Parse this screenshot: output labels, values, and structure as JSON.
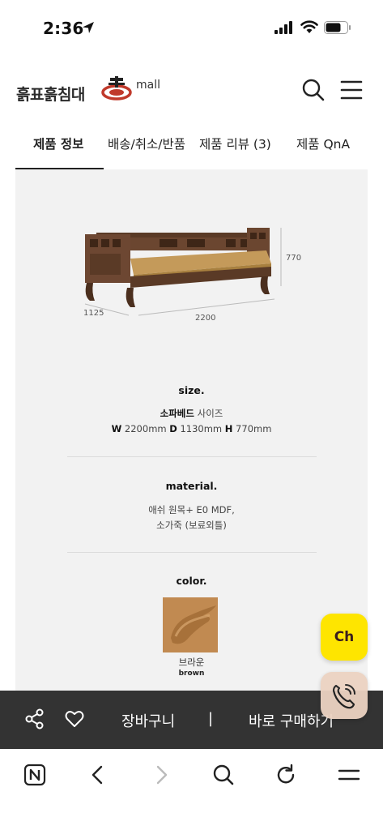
{
  "status_bar": {
    "time": "2:36",
    "icons": [
      "location-arrow-icon",
      "cellular-signal-icon",
      "wifi-icon",
      "battery-icon"
    ]
  },
  "header": {
    "logo_text": "흙표흙침대",
    "logo_suffix": "mall",
    "icons": [
      "search-icon",
      "hamburger-menu-icon"
    ]
  },
  "tabs": [
    {
      "label": "제품 정보",
      "active": true
    },
    {
      "label": "배송/취소/반품",
      "active": false
    },
    {
      "label": "제품 리뷰 (3)",
      "active": false
    },
    {
      "label": "제품 QnA",
      "active": false
    }
  ],
  "product": {
    "dimensions": {
      "height": "770",
      "depth": "1125",
      "width": "2200"
    },
    "size": {
      "title": "size.",
      "line1_bold": "소파베드",
      "line1_rest": " 사이즈",
      "w_label": "W",
      "w_value": " 2200mm ",
      "d_label": "D",
      "d_value": " 1130mm ",
      "h_label": "H",
      "h_value": " 770mm"
    },
    "material": {
      "title": "material.",
      "line1": "애쉬 원목+ E0 MDF,",
      "line2": "소가죽 (보료외틀)"
    },
    "color": {
      "title": "color.",
      "swatch_color": "#c18a51",
      "name_ko": "브라운",
      "name_en": "brown"
    }
  },
  "floating": {
    "chat_label": "Ch",
    "chat_color": "#fee500",
    "call_icon": "phone-call-icon"
  },
  "buy_bar": {
    "cart_label": "장바구니",
    "separator": "|",
    "buy_label": "바로 구매하기",
    "icons": [
      "share-icon",
      "heart-icon"
    ]
  },
  "browser_toolbar": {
    "icons": [
      "naver-n-icon",
      "back-arrow-icon",
      "forward-arrow-icon",
      "search-icon",
      "reload-icon",
      "menu-icon"
    ]
  }
}
